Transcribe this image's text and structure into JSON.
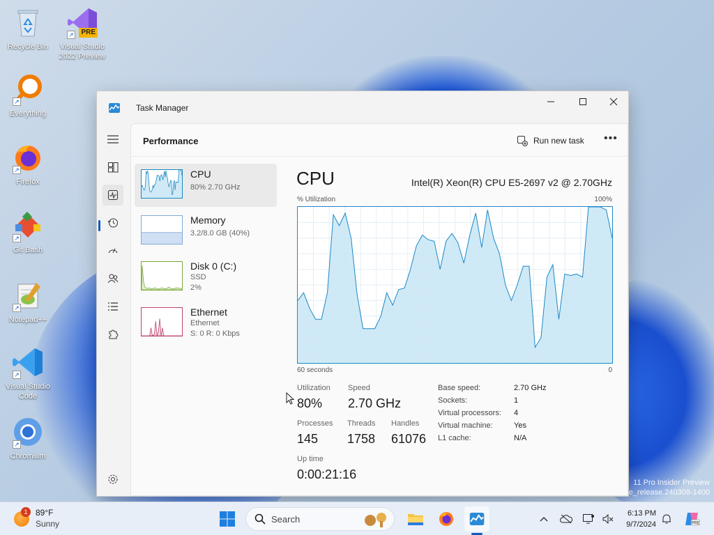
{
  "desktop": {
    "icons": [
      {
        "label": "Recycle Bin"
      },
      {
        "label": "Visual Studio 2022 Preview",
        "badge": "PRE"
      },
      {
        "label": "Everything"
      },
      {
        "label": "Firefox"
      },
      {
        "label": "Git Bash"
      },
      {
        "label": "Notepad++"
      },
      {
        "label": "Visual Studio Code"
      },
      {
        "label": "Chromium"
      }
    ],
    "watermark_line1": "11 Pro Insider Preview",
    "watermark_line2": "e_release.240308-1400"
  },
  "window": {
    "title": "Task Manager",
    "page_title": "Performance",
    "run_new_task": "Run new task",
    "more": "•••"
  },
  "resources": [
    {
      "name": "CPU",
      "line1": "80% 2.70 GHz",
      "line2": ""
    },
    {
      "name": "Memory",
      "line1": "3.2/8.0 GB (40%)",
      "line2": ""
    },
    {
      "name": "Disk 0 (C:)",
      "line1": "SSD",
      "line2": "2%"
    },
    {
      "name": "Ethernet",
      "line1": "Ethernet",
      "line2": "S: 0 R: 0 Kbps"
    }
  ],
  "cpu": {
    "title": "CPU",
    "model": "Intel(R) Xeon(R) CPU E5-2697 v2 @ 2.70GHz",
    "y_label": "% Utilization",
    "y_max_label": "100%",
    "x_left_label": "60 seconds",
    "x_right_label": "0",
    "utilization_history": [
      40,
      45,
      35,
      28,
      28,
      45,
      95,
      88,
      96,
      80,
      44,
      22,
      22,
      22,
      30,
      45,
      37,
      47,
      48,
      60,
      75,
      82,
      79,
      78,
      60,
      78,
      83,
      77,
      64,
      82,
      96,
      74,
      98,
      80,
      70,
      50,
      40,
      50,
      62,
      62,
      10,
      16,
      55,
      63,
      28,
      57,
      56,
      57,
      55,
      100,
      100,
      100,
      98,
      80
    ],
    "stats": {
      "utilization_label": "Utilization",
      "utilization": "80%",
      "speed_label": "Speed",
      "speed": "2.70 GHz",
      "processes_label": "Processes",
      "processes": "145",
      "threads_label": "Threads",
      "threads": "1758",
      "handles_label": "Handles",
      "handles": "61076",
      "uptime_label": "Up time",
      "uptime": "0:00:21:16"
    },
    "specs": [
      {
        "label": "Base speed:",
        "value": "2.70 GHz"
      },
      {
        "label": "Sockets:",
        "value": "1"
      },
      {
        "label": "Virtual processors:",
        "value": "4"
      },
      {
        "label": "Virtual machine:",
        "value": "Yes"
      },
      {
        "label": "L1 cache:",
        "value": "N/A"
      }
    ]
  },
  "taskbar": {
    "weather_badge": "1",
    "temperature": "89°F",
    "condition": "Sunny",
    "search_placeholder": "Search",
    "time": "6:13 PM",
    "date": "9/7/2024"
  },
  "colors": {
    "cpu_line": "#1b87c5",
    "cpu_fill": "#c7e6f5",
    "memory": "#7fa8d8",
    "disk": "#7aa83c",
    "ethernet": "#c0436e",
    "accent": "#0f5bbd"
  }
}
